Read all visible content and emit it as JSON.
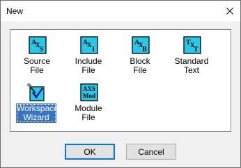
{
  "window": {
    "title": "New"
  },
  "items": [
    {
      "line1": "Source",
      "line2": "File",
      "icon_text": "AXS",
      "icon": "source-file-icon"
    },
    {
      "line1": "Include",
      "line2": "File",
      "icon_text": "AXI",
      "icon": "include-file-icon"
    },
    {
      "line1": "Block",
      "line2": "File",
      "icon_text": "AXB",
      "icon": "block-file-icon"
    },
    {
      "line1": "Standard",
      "line2": "Text",
      "icon_text": "TXT",
      "icon": "standard-text-icon"
    },
    {
      "line1": "Workspace",
      "line2": "Wizard",
      "icon": "workspace-wizard-icon",
      "selected": true
    },
    {
      "line1": "Module",
      "line2": "File",
      "icon_text1": "AXS",
      "icon_text2": "Mod",
      "icon": "module-file-icon"
    }
  ],
  "buttons": {
    "ok": "OK",
    "cancel": "Cancel"
  },
  "colors": {
    "icon_cyan": "#29c7e8",
    "selection": "#3a74c4",
    "default_button_border": "#0078d7"
  }
}
